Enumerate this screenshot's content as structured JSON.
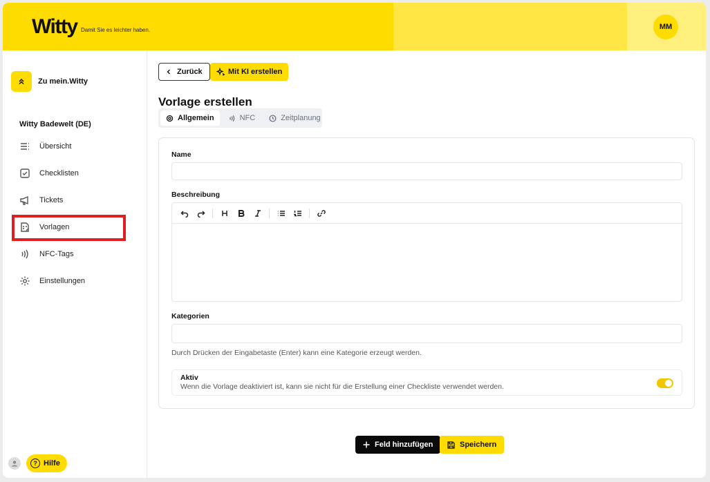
{
  "header": {
    "logo": "Witty",
    "tagline": "Damit Sie es leichter haben.",
    "user_initials": "MM"
  },
  "sidebar": {
    "back_label": "Zu mein.Witty",
    "org_name": "Witty Badewelt (DE)",
    "items": [
      {
        "label": "Übersicht",
        "icon": "list-icon"
      },
      {
        "label": "Checklisten",
        "icon": "checkbox-icon"
      },
      {
        "label": "Tickets",
        "icon": "megaphone-icon"
      },
      {
        "label": "Vorlagen",
        "icon": "template-icon"
      },
      {
        "label": "NFC-Tags",
        "icon": "nfc-icon"
      },
      {
        "label": "Einstellungen",
        "icon": "gear-icon"
      }
    ],
    "help_label": "Hilfe"
  },
  "toolbar": {
    "back_label": "Zurück",
    "ai_label": "Mit KI erstellen"
  },
  "page": {
    "title": "Vorlage erstellen",
    "tabs": [
      {
        "label": "Allgemein",
        "active": true
      },
      {
        "label": "NFC",
        "active": false
      },
      {
        "label": "Zeitplanung",
        "active": false
      }
    ]
  },
  "form": {
    "name_label": "Name",
    "name_value": "",
    "description_label": "Beschreibung",
    "description_value": "",
    "categories_label": "Kategorien",
    "categories_value": "",
    "categories_hint": "Durch Drücken der Eingabetaste (Enter) kann eine Kategorie erzeugt werden.",
    "active_title": "Aktiv",
    "active_description": "Wenn die Vorlage deaktiviert ist, kann sie nicht für die Erstellung einer Checkliste verwendet werden.",
    "active_on": true
  },
  "actions": {
    "add_field_label": "Feld hinzufügen",
    "save_label": "Speichern"
  },
  "colors": {
    "brand_yellow": "#ffdc00",
    "highlight_red": "#e02020"
  }
}
